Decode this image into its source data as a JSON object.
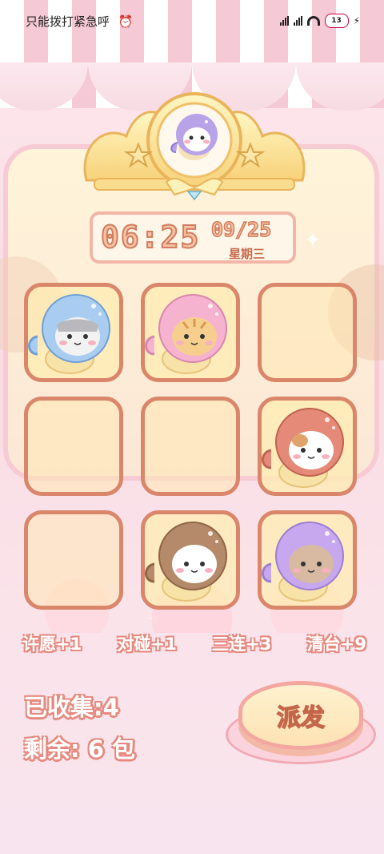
{
  "status_bar": {
    "left_text": "只能拨打紧急呼",
    "battery": "13"
  },
  "clock": {
    "time": "06:25",
    "date": "09/25",
    "weekday": "星期三"
  },
  "colors": {
    "purple": "#b9a3e8",
    "blue": "#a9cdf0",
    "pink": "#f5b3cf",
    "red": "#e58a78",
    "brown": "#b58a6a",
    "lilac": "#c7a7ee",
    "cream": "#fff4e3"
  },
  "crown_character": {
    "hood": "purple-icon"
  },
  "grid": [
    {
      "state": "character",
      "hood": "blue",
      "face": "cat"
    },
    {
      "state": "character",
      "hood": "pink",
      "face": "tabby"
    },
    {
      "state": "empty"
    },
    {
      "state": "empty"
    },
    {
      "state": "empty"
    },
    {
      "state": "character",
      "hood": "red",
      "face": "calico"
    },
    {
      "state": "empty"
    },
    {
      "state": "character",
      "hood": "brown",
      "face": "white"
    },
    {
      "state": "character",
      "hood": "lilac",
      "face": "brown"
    }
  ],
  "bonuses": [
    "许愿+1",
    "对碰+1",
    "三连+3",
    "清台+9"
  ],
  "collected": "已收集:4",
  "remaining": "剩余: 6 包",
  "deal_label": "派发"
}
